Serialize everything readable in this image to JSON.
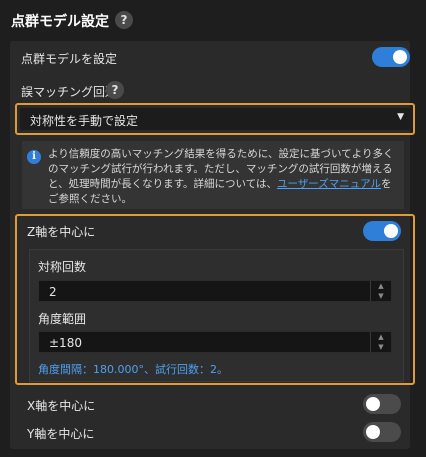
{
  "header": {
    "title": "点群モデル設定",
    "help": "?"
  },
  "point_cloud": {
    "label": "点群モデルを設定",
    "enabled": true
  },
  "mismatch": {
    "label": "誤マッチング回避",
    "help": "?",
    "selected": "対称性を手動で設定"
  },
  "info": {
    "icon": "i",
    "text_before": "より信頼度の高いマッチング結果を得るために、設定に基づいてより多くのマッチング試行が行われます。ただし、マッチングの試行回数が増えると、処理時間が長くなります。詳細については、",
    "link": "ユーザーズマニュアル",
    "text_after": "をご参照ください。"
  },
  "z_axis": {
    "label": "Z軸を中心に",
    "enabled": true,
    "symmetry_count": {
      "label": "対称回数",
      "value": "2"
    },
    "angle_range": {
      "label": "角度範囲",
      "value": "±180"
    },
    "note": "角度間隔：180.000°、試行回数：2。"
  },
  "x_axis": {
    "label": "X軸を中心に",
    "enabled": false
  },
  "y_axis": {
    "label": "Y軸を中心に",
    "enabled": false
  },
  "colors": {
    "accent": "#2f7fd8",
    "highlight": "#e09a36",
    "link": "#4ea1f3"
  }
}
